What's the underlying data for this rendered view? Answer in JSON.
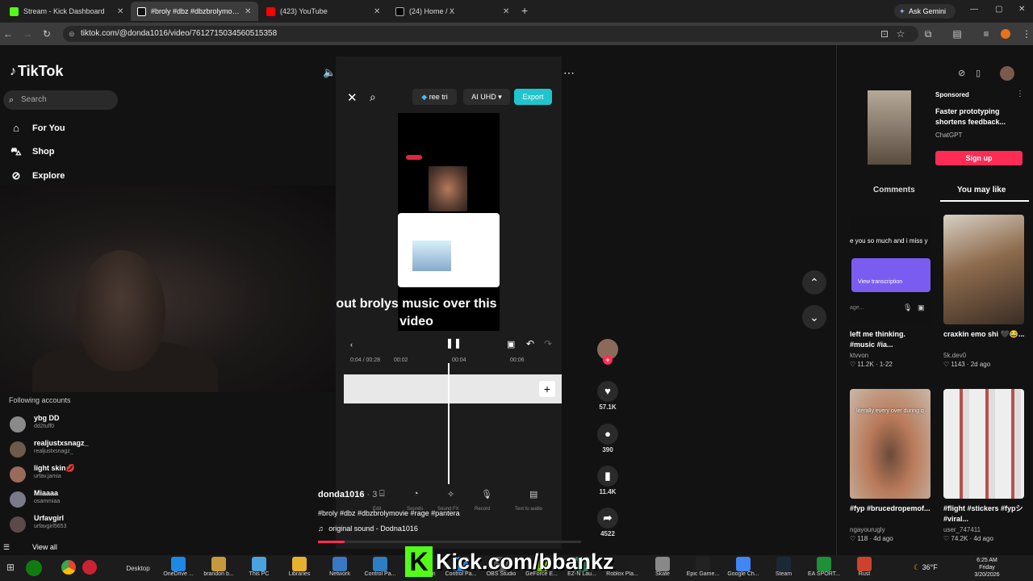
{
  "browser": {
    "tabs": [
      {
        "label": "Stream - Kick Dashboard",
        "color": "#53fc18"
      },
      {
        "label": "#broly #dbz #dbzbrolymovie",
        "color": "#000000"
      },
      {
        "label": "(423) YouTube",
        "color": "#ff0000"
      },
      {
        "label": "(24) Home / X",
        "color": "#000000"
      }
    ],
    "ask_gemini": "Ask Gemini",
    "url": "tiktok.com/@donda1016/video/7612715034560515358"
  },
  "tiktok": {
    "logo": "TikTok",
    "search_placeholder": "Search",
    "nav": [
      {
        "label": "For You",
        "icon": "home-icon"
      },
      {
        "label": "Shop",
        "icon": "shop-icon"
      },
      {
        "label": "Explore",
        "icon": "compass-icon"
      }
    ],
    "following_header": "Following accounts",
    "following": [
      {
        "name": "ybg DD",
        "handle": "dd2tuff0"
      },
      {
        "name": "realjustxsnagz_",
        "handle": "realjustxsnagz_"
      },
      {
        "name": "light skin💋",
        "handle": "urfav.jamia"
      },
      {
        "name": "Miaaaa",
        "handle": "osammiaa"
      },
      {
        "name": "Urfavgirl",
        "handle": "urfavgirl5653"
      }
    ],
    "view_all": "View all"
  },
  "video": {
    "trial_label": "ree tri",
    "uhd_label": "AI UHD ▾",
    "export_label": "Export",
    "caption": "out brolys music over this video",
    "time_current": "0:04",
    "time_total": "00:28",
    "ticks": [
      "00:02",
      "00:04",
      "00:06"
    ],
    "edit_tools": [
      "Edit",
      "Sounds",
      "Sound FX",
      "Record",
      "Text to audio"
    ],
    "author": "donda1016",
    "author_suffix": "· 3",
    "tags": "#broly #dbz #dbzbrolymovie #rage #pantera",
    "sound": "original sound - Dodna1016",
    "progress": 0.1
  },
  "actions": {
    "likes": "57.1K",
    "comments": "390",
    "saves": "11.4K",
    "shares": "4522"
  },
  "sponsored": {
    "tag": "Sponsored",
    "title": "Faster prototyping shortens feedback...",
    "brand": "ChatGPT",
    "cta": "Sign up"
  },
  "right_tabs": {
    "comments": "Comments",
    "you_may_like": "You may like"
  },
  "recommended": [
    {
      "title": "left me thinking. #music #ia...",
      "user": "ktvvon",
      "likes": "11.2K",
      "date": "1-22",
      "overlay": "e you so much and i miss y",
      "transcription": "View transcription",
      "input_hint": "age..."
    },
    {
      "title": "craxkin emo shi 🖤😂...",
      "user": "5k.dev0",
      "likes": "1143",
      "date": "2d ago"
    },
    {
      "title": "#fyp #brucedropemof...",
      "user": "ngayourugly",
      "likes": "118",
      "date": "4d ago",
      "overlay": "literally every over during q"
    },
    {
      "title": "#flight #stickers #fypシ #viral...",
      "user": "user_747411",
      "likes": "74.2K",
      "date": "4d ago"
    }
  ],
  "taskbar": {
    "items": [
      "Desktop",
      "OneDrive ...",
      "brandon b...",
      "This PC",
      "Libraries",
      "Network",
      "Control Pa...",
      "Recycle Bin",
      "Control Pa...",
      "OBS Studio",
      "GeForce E...",
      "EZ-N Lau...",
      "Roblox Pla...",
      "Skate",
      "Epic Game...",
      "Google Ch...",
      "Steam",
      "EA SPORT...",
      "Rust"
    ],
    "overlay_text": "Kick.com/bbankz",
    "weather": "36°F",
    "time": "6:25 AM",
    "day": "Friday",
    "date": "3/20/2026"
  }
}
